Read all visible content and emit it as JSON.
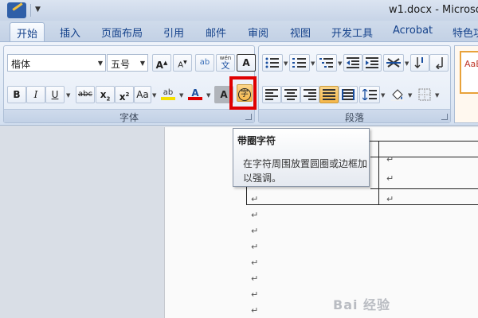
{
  "window": {
    "title": "w1.docx - Microso"
  },
  "quick_access": {
    "dropdown_icon": "▼",
    "word_icon": "word-app-icon"
  },
  "tabs": [
    "开始",
    "插入",
    "页面布局",
    "引用",
    "邮件",
    "审阅",
    "视图",
    "开发工具",
    "Acrobat",
    "特色功"
  ],
  "active_tab": "开始",
  "font_group": {
    "label": "字体",
    "font_name": "楷体",
    "font_size": "五号",
    "grow_font": "A",
    "shrink_font": "A",
    "clear_format_text": "ab",
    "phonetic_guide": "wén",
    "phonetic_char": "文",
    "char_border": "A",
    "bold": "B",
    "italic": "I",
    "underline": "U",
    "strikethrough": "abc",
    "subscript": "x",
    "superscript": "x",
    "sub_mark": "2",
    "sup_mark": "2",
    "change_case": "Aa",
    "highlight": "ab",
    "font_color": "A",
    "char_shading": "A",
    "enclose_char": "字"
  },
  "paragraph_group": {
    "label": "段落"
  },
  "styles_preview": "AaBb",
  "tooltip": {
    "title": "带圈字符",
    "body": "在字符周围放置圆圈或边框加以强调。"
  },
  "document": {
    "paragraph_mark": "↵"
  },
  "watermark": "Bai 经验",
  "colors": {
    "highlight_bar": "#f5e000",
    "font_color_bar": "#e00000",
    "callout_box": "#e00000",
    "pressed_button": "#f6b749"
  }
}
